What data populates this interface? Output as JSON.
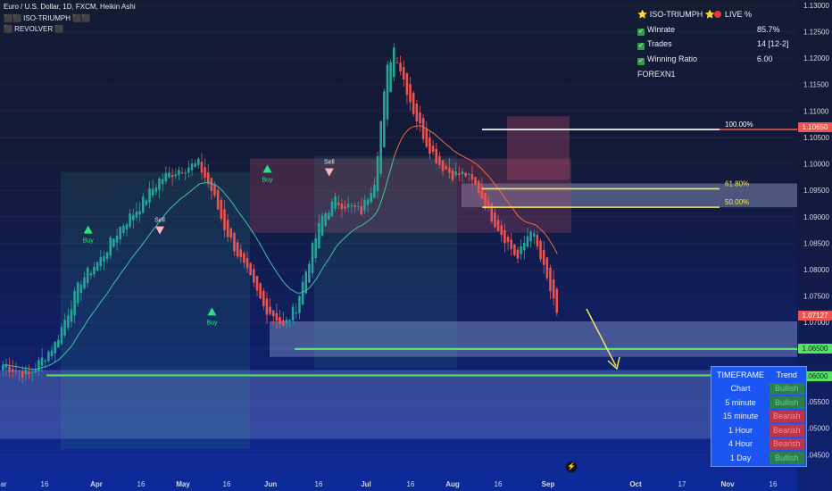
{
  "header": {
    "line1": "Euro / U.S. Dollar, 1D, FXCM, Heikin Ashi",
    "line2": "⬛⬛ ISO-TRIUMPH ⬛⬛",
    "line3": "⬛ REVOLVER ⬛"
  },
  "stats_panel": {
    "title": "⭐ ISO-TRIUMPH ⭐",
    "live": "LIVE %",
    "rows": [
      {
        "label": "Winrate",
        "value": "85.7%"
      },
      {
        "label": "Trades",
        "value": "14 [12-2]"
      },
      {
        "label": "Winning Ratio",
        "value": "6.00"
      }
    ],
    "footer": "FOREXN1"
  },
  "timeframe_table": {
    "header": [
      "TIMEFRAME",
      "Trend"
    ],
    "rows": [
      {
        "tf": "Chart",
        "trend": "Bullish"
      },
      {
        "tf": "5 minute",
        "trend": "Bullish"
      },
      {
        "tf": "15 minute",
        "trend": "Bearish"
      },
      {
        "tf": "1 Hour",
        "trend": "Bearish"
      },
      {
        "tf": "4 Hour",
        "trend": "Bearish"
      },
      {
        "tf": "1 Day",
        "trend": "Bullish"
      }
    ]
  },
  "colors": {
    "bull": "#26a69a",
    "bear": "#ef5350",
    "fib_top": "#ffffff",
    "fib_mid": "#f2e85a",
    "support": "#57e36a",
    "accent": "#1c56f2"
  },
  "chart_data": {
    "type": "candlestick",
    "title": "Euro / U.S. Dollar, 1D, FXCM, Heikin Ashi",
    "y_ticks": [
      1.13,
      1.125,
      1.12,
      1.115,
      1.11,
      1.105,
      1.1,
      1.095,
      1.09,
      1.085,
      1.08,
      1.075,
      1.07,
      1.065,
      1.06,
      1.055,
      1.05,
      1.045
    ],
    "y_tick_labels": [
      "1.13000",
      "1.12500",
      "1.12000",
      "1.11500",
      "1.11000",
      "1.10500",
      "1.10000",
      "1.09500",
      "1.09000",
      "1.08500",
      "1.08000",
      "1.07500",
      "1.07000",
      "1.06500",
      "1.06000",
      "1.05500",
      "1.05000",
      "1.04500"
    ],
    "ylim": [
      1.0415,
      1.131
    ],
    "x_ticks": [
      {
        "label": "ar",
        "bold": false
      },
      {
        "label": "16",
        "bold": false
      },
      {
        "label": "Apr",
        "bold": true
      },
      {
        "label": "16",
        "bold": false
      },
      {
        "label": "May",
        "bold": true
      },
      {
        "label": "16",
        "bold": false
      },
      {
        "label": "Jun",
        "bold": true
      },
      {
        "label": "16",
        "bold": false
      },
      {
        "label": "Jul",
        "bold": true
      },
      {
        "label": "16",
        "bold": false
      },
      {
        "label": "Aug",
        "bold": true
      },
      {
        "label": "16",
        "bold": false
      },
      {
        "label": "Sep",
        "bold": true
      },
      {
        "label": "Oct",
        "bold": true
      },
      {
        "label": "17",
        "bold": false
      },
      {
        "label": "Nov",
        "bold": true
      },
      {
        "label": "16",
        "bold": false
      }
    ],
    "close_path": [
      [
        0,
        1.062
      ],
      [
        8,
        1.06
      ],
      [
        16,
        1.066
      ],
      [
        24,
        1.078
      ],
      [
        30,
        1.082
      ],
      [
        36,
        1.088
      ],
      [
        42,
        1.092
      ],
      [
        48,
        1.097
      ],
      [
        54,
        1.099
      ],
      [
        60,
        1.1
      ],
      [
        64,
        1.095
      ],
      [
        68,
        1.088
      ],
      [
        72,
        1.083
      ],
      [
        76,
        1.078
      ],
      [
        80,
        1.073
      ],
      [
        84,
        1.071
      ],
      [
        86,
        1.069
      ],
      [
        90,
        1.073
      ],
      [
        94,
        1.082
      ],
      [
        98,
        1.09
      ],
      [
        102,
        1.093
      ],
      [
        106,
        1.092
      ],
      [
        110,
        1.091
      ],
      [
        114,
        1.097
      ],
      [
        116,
        1.108
      ],
      [
        118,
        1.118
      ],
      [
        120,
        1.122
      ],
      [
        124,
        1.114
      ],
      [
        126,
        1.11
      ],
      [
        130,
        1.104
      ],
      [
        134,
        1.1
      ],
      [
        138,
        1.098
      ],
      [
        142,
        1.098
      ],
      [
        146,
        1.095
      ],
      [
        150,
        1.09
      ],
      [
        154,
        1.086
      ],
      [
        158,
        1.082
      ],
      [
        162,
        1.088
      ],
      [
        164,
        1.084
      ],
      [
        168,
        1.076
      ],
      [
        170,
        1.071
      ]
    ],
    "last_price": "1.07127",
    "price_labels": [
      {
        "value": "1.10650",
        "color": "#ef5350"
      },
      {
        "value": "1.07127",
        "color": "#ef5350"
      },
      {
        "value": "1.06500",
        "color": "#57e36a"
      },
      {
        "value": "1.06000",
        "color": "#57e36a"
      }
    ],
    "fib_levels": [
      {
        "label": "100.00%",
        "price": 1.1065
      },
      {
        "label": "61.80%",
        "price": 1.0953
      },
      {
        "label": "50.00%",
        "price": 1.0918
      }
    ],
    "support_levels": [
      1.065,
      1.06
    ],
    "signals": [
      {
        "type": "Buy",
        "bar": 26,
        "price": 1.0875
      },
      {
        "type": "Sell",
        "bar": 48,
        "price": 1.0875
      },
      {
        "type": "Buy",
        "bar": 64,
        "price": 1.072
      },
      {
        "type": "Buy",
        "bar": 81,
        "price": 1.099
      },
      {
        "type": "Sell",
        "bar": 100,
        "price": 1.0985
      }
    ],
    "signal_labels": {
      "buy": "Buy",
      "sell": "Sell"
    }
  }
}
